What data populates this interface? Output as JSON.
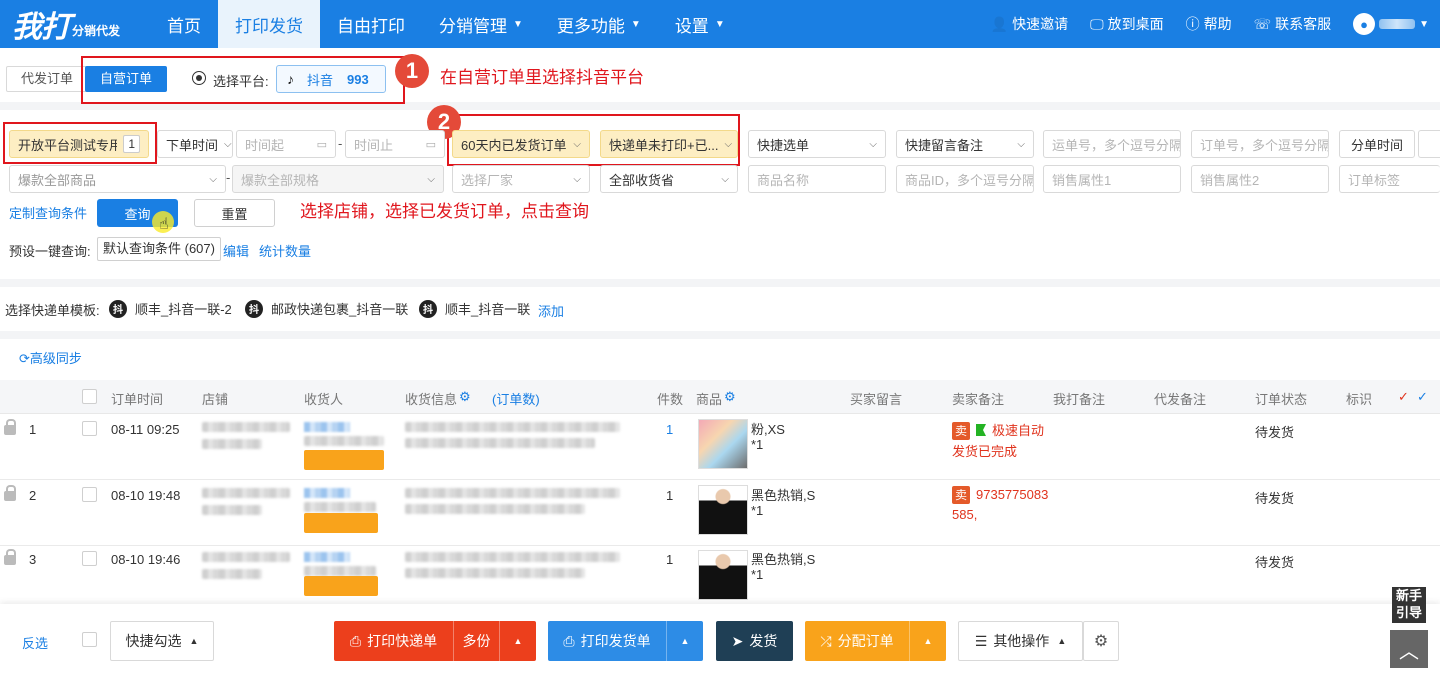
{
  "logo": {
    "main": "我打",
    "sub": "分销代发"
  },
  "nav": {
    "items": [
      {
        "label": "首页"
      },
      {
        "label": "打印发货"
      },
      {
        "label": "自由打印"
      },
      {
        "label": "分销管理"
      },
      {
        "label": "更多功能"
      },
      {
        "label": "设置"
      }
    ],
    "right": {
      "invite": "快速邀请",
      "desktop": "放到桌面",
      "help": "帮助",
      "service": "联系客服"
    }
  },
  "mode": {
    "tab_daifa": "代发订单",
    "tab_ziying": "自营订单",
    "platform_label": "选择平台:",
    "platform_name": "抖音",
    "platform_count": "993"
  },
  "annotations": {
    "step1": "1",
    "step1_text": "在自营订单里选择抖音平台",
    "step2": "2",
    "step2_text": "选择店铺，选择已发货订单，点击查询"
  },
  "filters": {
    "shop": "开放平台测试专用店",
    "shop_count": "1",
    "time_type": "下单时间",
    "time_start": "时间起",
    "time_end": "时间止",
    "order_range": "60天内已发货订单",
    "print_status": "快递单未打印+已...",
    "quick_select": "快捷选单",
    "quick_remark": "快捷留言备注",
    "waybill_ph": "运单号，多个逗号分隔",
    "order_no_ph": "订单号，多个逗号分隔",
    "split_time": "分单时间",
    "goods": "爆款全部商品",
    "specs": "爆款全部规格",
    "factory": "选择厂家",
    "province": "全部收货省",
    "goods_name_ph": "商品名称",
    "goods_id_ph": "商品ID，多个逗号分隔",
    "attr1_ph": "销售属性1",
    "attr2_ph": "销售属性2",
    "order_tag_ph": "订单标签"
  },
  "actions": {
    "custom": "定制查询条件",
    "query": "查询",
    "reset": "重置",
    "preset_label": "预设一键查询:",
    "preset_value": "默认查询条件 (607)",
    "edit": "编辑",
    "count": "统计数量"
  },
  "templates": {
    "label": "选择快递单模板:",
    "items": [
      {
        "icon": "抖",
        "name": "顺丰_抖音一联-2"
      },
      {
        "icon": "抖",
        "name": "邮政快递包裹_抖音一联"
      },
      {
        "icon": "抖",
        "name": "顺丰_抖音一联"
      }
    ],
    "add": "添加"
  },
  "sync": "高级同步",
  "table": {
    "headers": {
      "time": "订单时间",
      "shop": "店铺",
      "receiver": "收货人",
      "address": "收货信息",
      "order_count": "(订单数)",
      "qty": "件数",
      "goods": "商品",
      "buyer_msg": "买家留言",
      "seller_note": "卖家备注",
      "my_note": "我打备注",
      "daifa_note": "代发备注",
      "status": "订单状态",
      "mark": "标识"
    },
    "rows": [
      {
        "index": "1",
        "time": "08-11 09:25",
        "qty": "1",
        "spec": "粉,XS",
        "spec_qty": "*1",
        "seller_badge": "卖",
        "seller_note_1": "极速自动",
        "seller_note_2": "发货已完成",
        "status": "待发货"
      },
      {
        "index": "2",
        "time": "08-10 19:48",
        "qty": "1",
        "spec": "黑色热销,S",
        "spec_qty": "*1",
        "seller_badge": "卖",
        "seller_note_1": "9735775083",
        "seller_note_2": "585,",
        "status": "待发货"
      },
      {
        "index": "3",
        "time": "08-10 19:46",
        "qty": "1",
        "spec": "黑色热销,S",
        "spec_qty": "*1",
        "status": "待发货"
      }
    ]
  },
  "bottom": {
    "invert": "反选",
    "quick_check": "快捷勾选",
    "print_waybill": "打印快递单",
    "multi": "多份",
    "print_ship": "打印发货单",
    "ship": "发货",
    "assign": "分配订单",
    "other": "其他操作"
  },
  "guide": {
    "line1": "新手",
    "line2": "引导"
  },
  "colors": {
    "primary": "#1a7fe3",
    "red": "#e0161d",
    "orange": "#f9a31b",
    "print_red": "#ec3f1c",
    "ship_dark": "#1f3f55"
  }
}
